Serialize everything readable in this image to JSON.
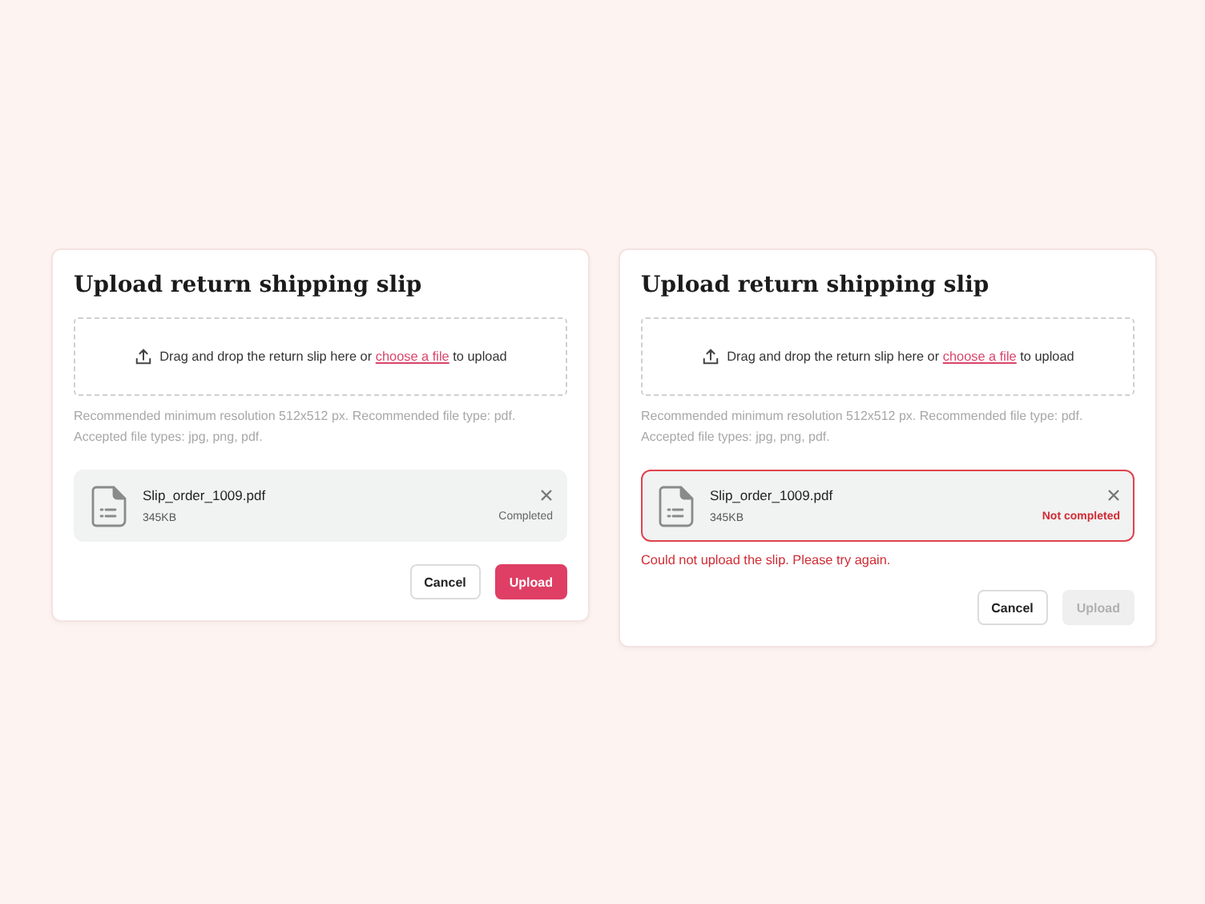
{
  "dialogs": [
    {
      "title": "Upload return shipping slip",
      "drop_zone": {
        "before": "Drag and drop the return slip here or",
        "link": "choose a file",
        "after": "to upload"
      },
      "hints": [
        "Recommended minimum resolution 512x512 px. Recommended file type: pdf.",
        "Accepted file types: jpg, png, pdf."
      ],
      "file": {
        "name": "Slip_order_1009.pdf",
        "size": "345KB",
        "status": "Completed",
        "error": false
      },
      "buttons": [
        {
          "label": "Cancel",
          "kind": "secondary",
          "disabled": false
        },
        {
          "label": "Upload",
          "kind": "primary",
          "disabled": false
        }
      ]
    },
    {
      "title": "Upload return shipping slip",
      "drop_zone": {
        "before": "Drag and drop the return slip here or",
        "link": "choose a file",
        "after": "to upload"
      },
      "hints": [
        "Recommended minimum resolution 512x512 px. Recommended file type: pdf.",
        "Accepted file types: jpg, png, pdf."
      ],
      "file": {
        "name": "Slip_order_1009.pdf",
        "size": "345KB",
        "status": "Not completed",
        "error": true
      },
      "error_message": "Could not upload the slip. Please try again.",
      "buttons": [
        {
          "label": "Cancel",
          "kind": "secondary",
          "disabled": false
        },
        {
          "label": "Upload",
          "kind": "primary",
          "disabled": true
        }
      ]
    }
  ]
}
